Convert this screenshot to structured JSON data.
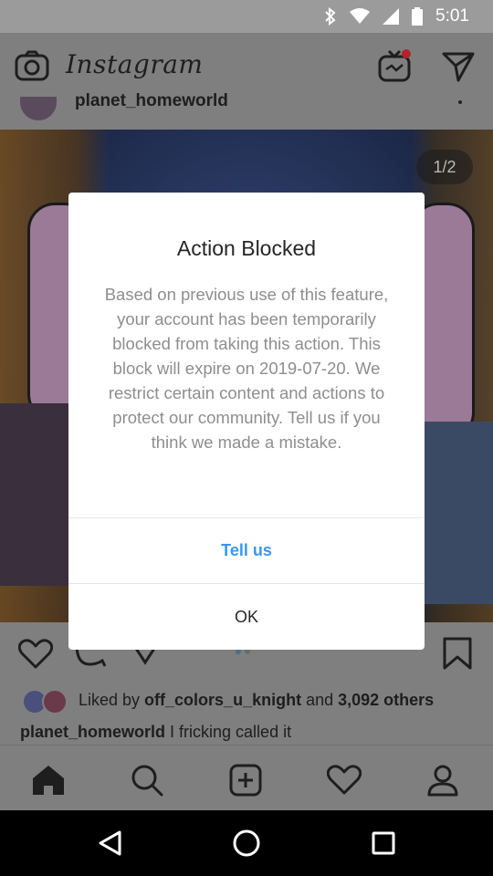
{
  "status_bar": {
    "time": "5:01",
    "icons": [
      "bluetooth-icon",
      "wifi-icon",
      "signal-icon",
      "battery-icon"
    ]
  },
  "app_header": {
    "brand": "Instagram",
    "icons": [
      "camera-icon",
      "igtv-icon",
      "direct-message-icon"
    ],
    "notification_color": "#b3232a"
  },
  "post": {
    "username": "planet_homeworld",
    "image_counter": "1/2",
    "liked_by_prefix": "Liked by ",
    "liked_by_user": "off_colors_u_knight",
    "liked_by_and": " and ",
    "liked_by_others": "3,092 others",
    "caption_user": "planet_homeworld",
    "caption_text": " I fricking called it",
    "carousel_position": 1,
    "carousel_total": 2
  },
  "bottom_nav": {
    "items": [
      "home-icon",
      "search-icon",
      "new-post-icon",
      "activity-icon",
      "profile-icon"
    ]
  },
  "system_nav": {
    "items": [
      "back-icon",
      "home-circle-icon",
      "recents-icon"
    ]
  },
  "dialog": {
    "title": "Action Blocked",
    "message": "Based on previous use of this feature, your account has been temporarily blocked from taking this action. This block will expire on 2019-07-20. We restrict certain content and actions to protect our community. Tell us if you think we made a mistake.",
    "primary_action": "Tell us",
    "secondary_action": "OK",
    "primary_color": "#3897f0"
  }
}
